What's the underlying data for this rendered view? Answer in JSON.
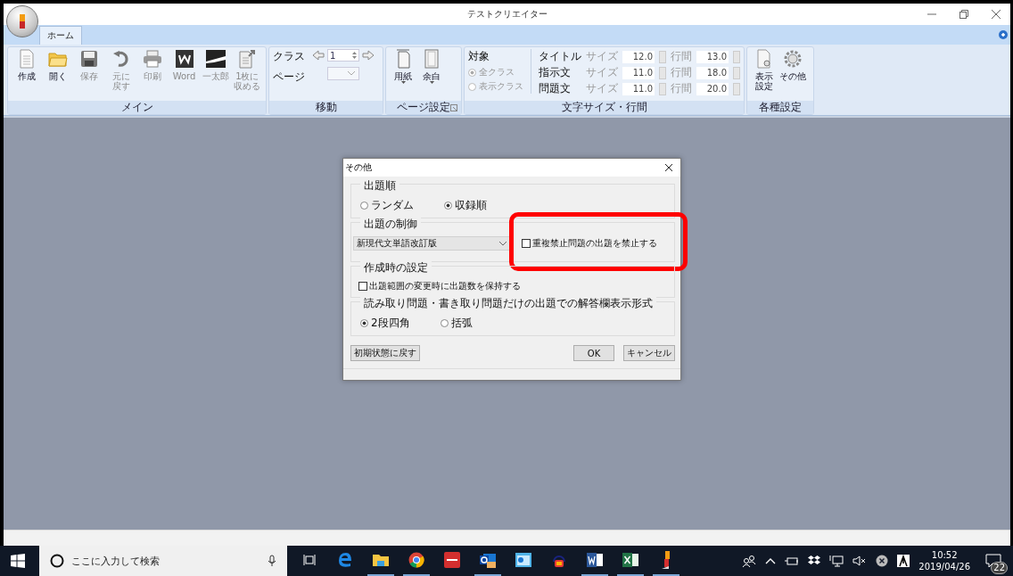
{
  "window": {
    "title": "テストクリエイター"
  },
  "tabs": [
    {
      "label": "ホーム",
      "selected": true
    }
  ],
  "ribbon": {
    "main": {
      "label": "メイン",
      "buttons": [
        {
          "kind": "new",
          "label": "作成",
          "disabled": false
        },
        {
          "kind": "open",
          "label": "開く",
          "disabled": false
        },
        {
          "kind": "save",
          "label": "保存",
          "disabled": true
        },
        {
          "kind": "undo",
          "lines": [
            "元に",
            "戻す"
          ],
          "disabled": true
        },
        {
          "kind": "print",
          "label": "印刷",
          "disabled": true
        },
        {
          "kind": "word",
          "label": "Word",
          "disabled": true
        },
        {
          "kind": "ichitaro",
          "label": "一太郎",
          "disabled": true
        },
        {
          "kind": "fit",
          "lines": [
            "1枚に",
            "収める"
          ],
          "disabled": true
        }
      ]
    },
    "move": {
      "label": "移動",
      "class_label": "クラス",
      "page_label": "ページ",
      "class_value": "1"
    },
    "page_setup": {
      "label": "ページ設定",
      "buttons": [
        {
          "kind": "paper",
          "label": "用紙"
        },
        {
          "kind": "margin",
          "label": "余白"
        }
      ]
    },
    "text_size": {
      "label": "文字サイズ・行間",
      "target_label": "対象",
      "targets": [
        {
          "label": "全クラス",
          "selected": true
        },
        {
          "label": "表示クラス",
          "selected": false
        }
      ],
      "rows": [
        {
          "name": "タイトル",
          "size_label": "サイズ",
          "size": "12.0",
          "spacing_label": "行間",
          "spacing": "13.0"
        },
        {
          "name": "指示文",
          "size_label": "サイズ",
          "size": "11.0",
          "spacing_label": "行間",
          "spacing": "18.0"
        },
        {
          "name": "問題文",
          "size_label": "サイズ",
          "size": "11.0",
          "spacing_label": "行間",
          "spacing": "20.0"
        }
      ]
    },
    "settings": {
      "label": "各種設定",
      "buttons": [
        {
          "kind": "display",
          "lines": [
            "表示",
            "設定"
          ]
        },
        {
          "kind": "gear",
          "label": "その他"
        }
      ]
    }
  },
  "dialog": {
    "title": "その他",
    "order": {
      "legend": "出題順",
      "options": [
        {
          "label": "ランダム",
          "selected": false
        },
        {
          "label": "収録順",
          "selected": true
        }
      ]
    },
    "control": {
      "legend": "出題の制御",
      "select_value": "新現代文単語改訂版",
      "checkbox": {
        "label": "重複禁止問題の出題を禁止する",
        "checked": false
      }
    },
    "create": {
      "legend": "作成時の設定",
      "checkbox": {
        "label": "出題範囲の変更時に出題数を保持する",
        "checked": false
      }
    },
    "answer": {
      "legend": "読み取り問題・書き取り問題だけの出題での解答欄表示形式",
      "options": [
        {
          "label": "2段四角",
          "selected": true
        },
        {
          "label": "括弧",
          "selected": false
        }
      ]
    },
    "reset_button": "初期状態に戻す",
    "ok_button": "OK",
    "cancel_button": "キャンセル"
  },
  "taskbar": {
    "search_placeholder": "ここに入力して検索",
    "apps": [
      {
        "kind": "taskview",
        "running": false
      },
      {
        "kind": "edge",
        "running": false
      },
      {
        "kind": "explorer",
        "running": true
      },
      {
        "kind": "chrome",
        "running": true
      },
      {
        "kind": "redapp",
        "running": false
      },
      {
        "kind": "outlook",
        "running": true
      },
      {
        "kind": "control",
        "running": false
      },
      {
        "kind": "audio",
        "running": false
      },
      {
        "kind": "word",
        "running": true
      },
      {
        "kind": "excel",
        "running": true
      },
      {
        "kind": "creator",
        "running": true
      }
    ],
    "time": "10:52",
    "date": "2019/04/26",
    "notifications": "22"
  }
}
